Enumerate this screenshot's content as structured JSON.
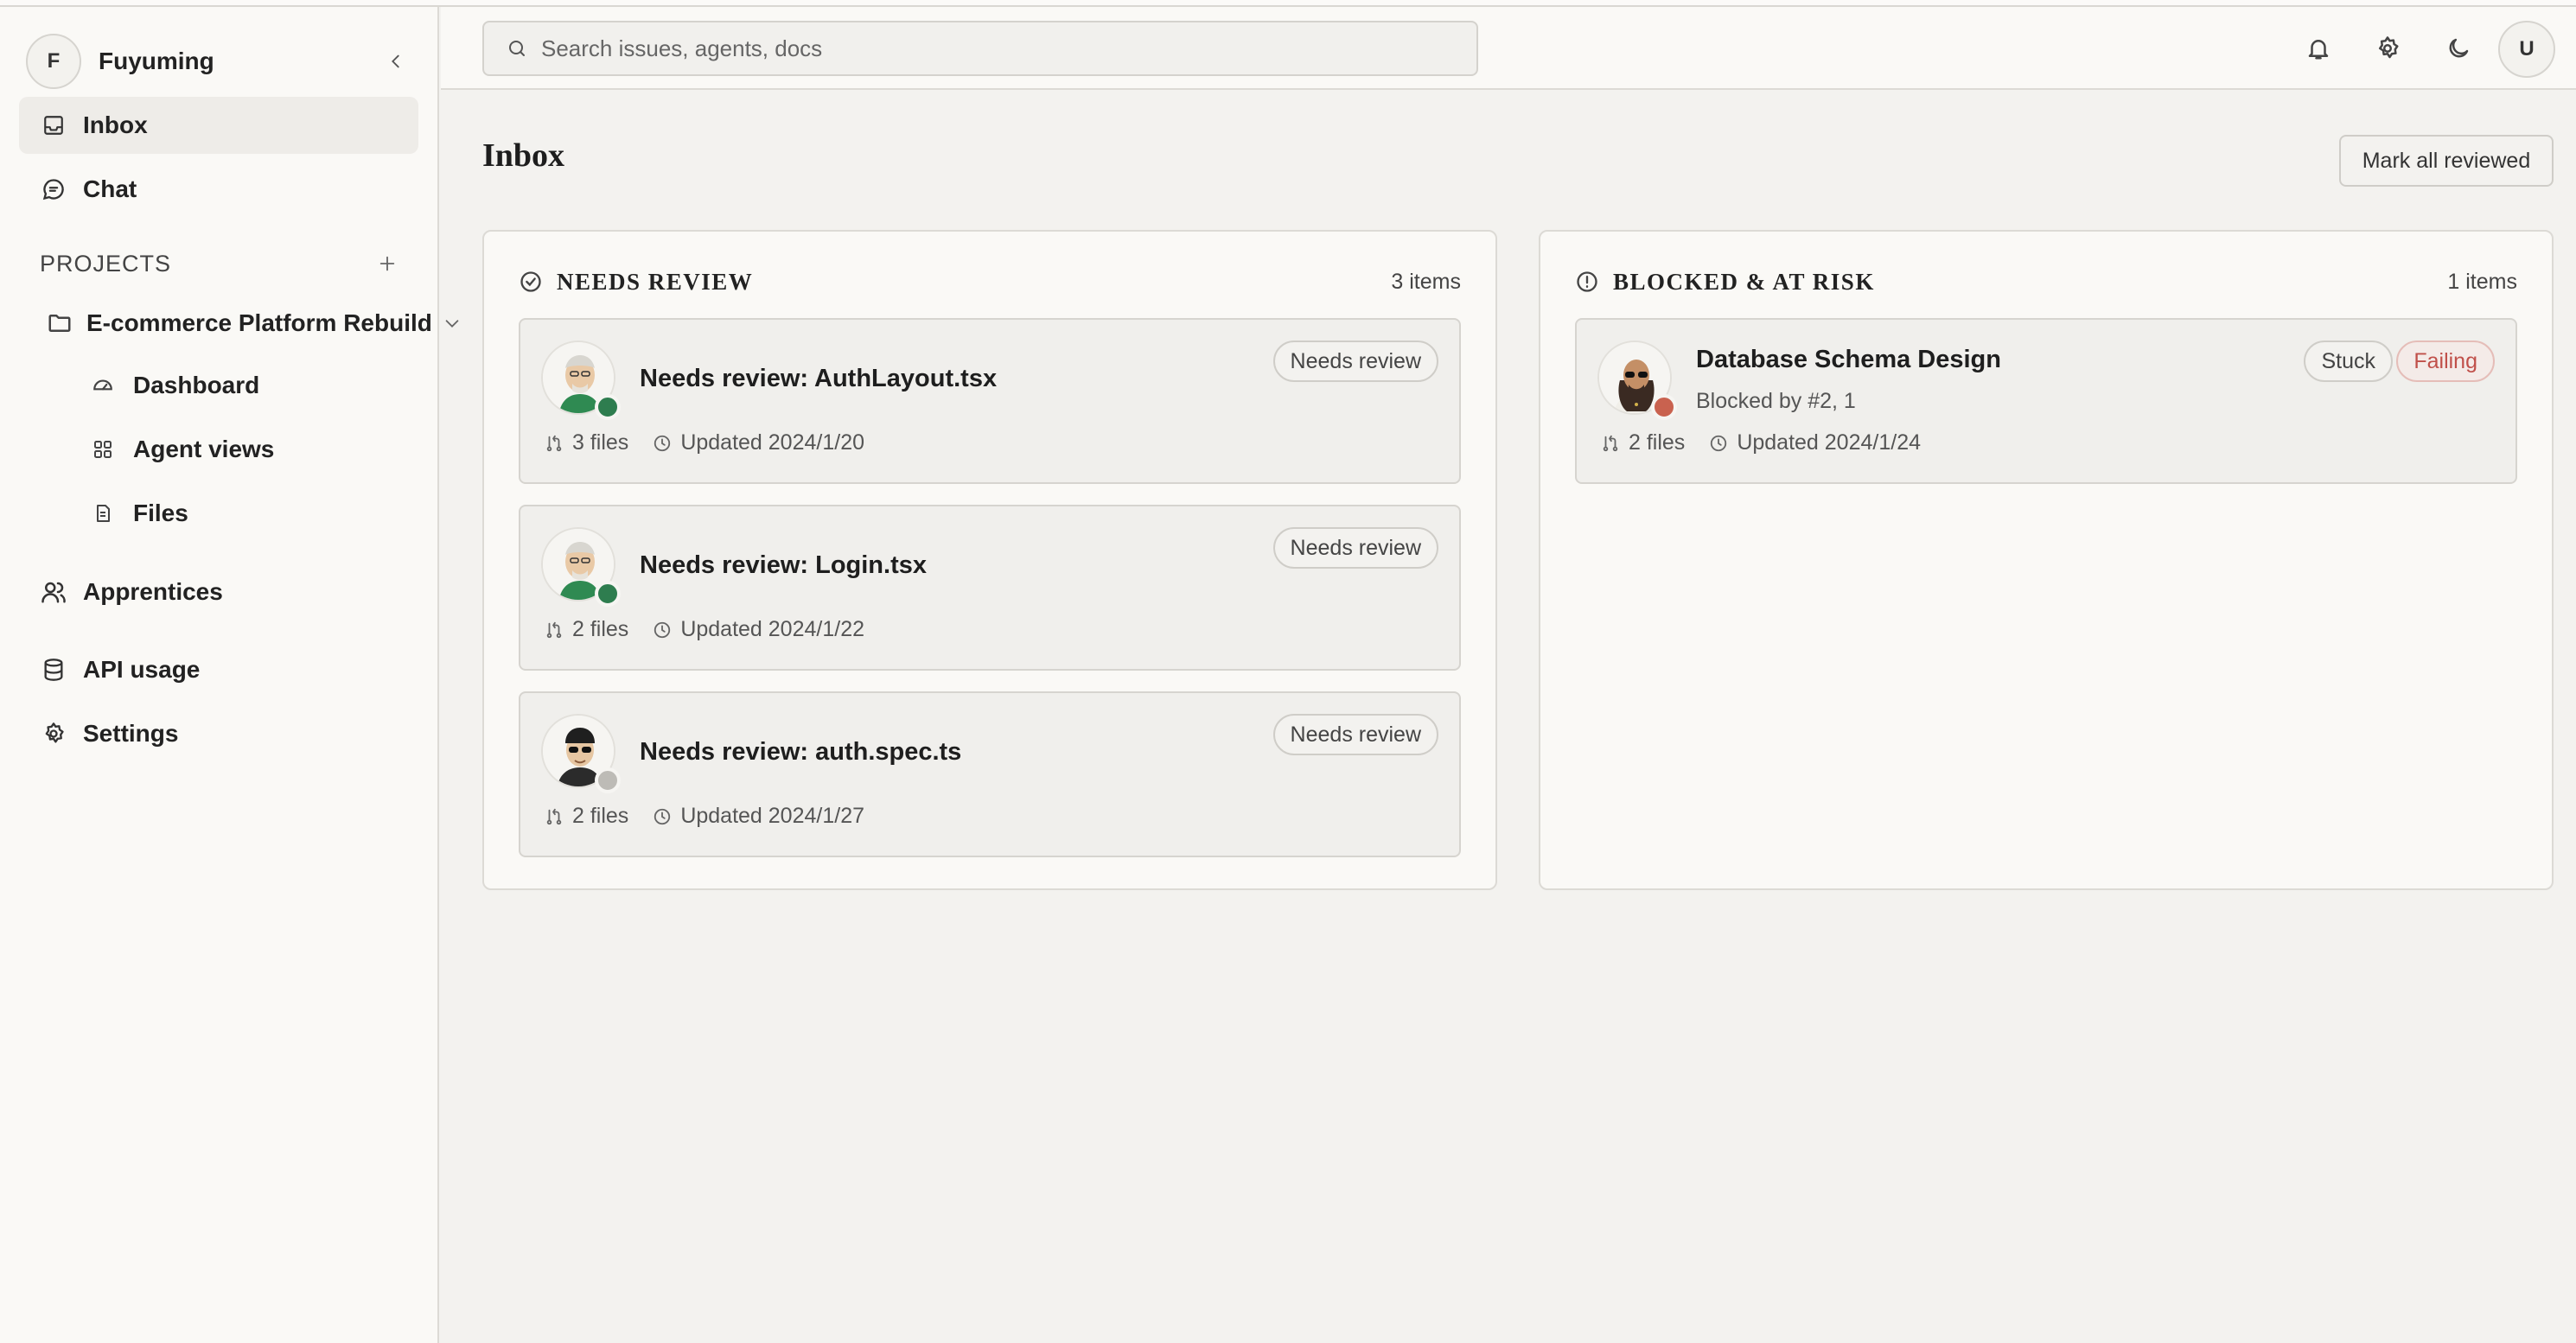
{
  "workspace": {
    "initial": "F",
    "name": "Fuyuming"
  },
  "nav": [
    {
      "label": "Inbox",
      "icon": "inbox-icon"
    },
    {
      "label": "Chat",
      "icon": "chat-icon"
    }
  ],
  "projects": {
    "header": "PROJECTS",
    "project_name": "E-commerce Platform Rebuild",
    "sub_items": [
      {
        "label": "Dashboard",
        "icon": "gauge-icon"
      },
      {
        "label": "Agent views",
        "icon": "grid-icon"
      },
      {
        "label": "Files",
        "icon": "file-icon"
      }
    ]
  },
  "bottom_nav": [
    {
      "label": "Apprentices",
      "icon": "users-icon"
    },
    {
      "label": "API usage",
      "icon": "database-icon"
    },
    {
      "label": "Settings",
      "icon": "gear-icon"
    }
  ],
  "topbar": {
    "search_placeholder": "Search issues, agents, docs",
    "user_initial": "U"
  },
  "main": {
    "title": "Inbox",
    "mark_all_label": "Mark all reviewed"
  },
  "panels": {
    "needs_review": {
      "title": "NEEDS REVIEW",
      "count": "3 items",
      "cards": [
        {
          "title": "Needs review: AuthLayout.tsx",
          "tag": "Needs review",
          "files": "3 files",
          "updated": "Updated 2024/1/20",
          "status_color": "#2e7d4f"
        },
        {
          "title": "Needs review: Login.tsx",
          "tag": "Needs review",
          "files": "2 files",
          "updated": "Updated 2024/1/22",
          "status_color": "#2e7d4f"
        },
        {
          "title": "Needs review: auth.spec.ts",
          "tag": "Needs review",
          "files": "2 files",
          "updated": "Updated 2024/1/27",
          "status_color": "#bdbbb6"
        }
      ]
    },
    "blocked": {
      "title": "BLOCKED & AT RISK",
      "count": "1 items",
      "cards": [
        {
          "title": "Database Schema Design",
          "subtitle": "Blocked by #2, 1",
          "tags": [
            "Stuck",
            "Failing"
          ],
          "files": "2 files",
          "updated": "Updated 2024/1/24",
          "status_color": "#c9624f"
        }
      ]
    }
  }
}
